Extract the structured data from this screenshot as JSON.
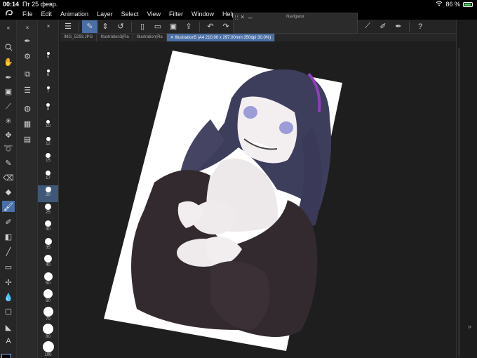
{
  "status": {
    "time": "00:14",
    "date": "Пт 25 февр.",
    "battery": "86 %"
  },
  "menu": [
    "File",
    "Edit",
    "Animation",
    "Layer",
    "Select",
    "View",
    "Filter",
    "Window",
    "Help"
  ],
  "navigator": {
    "title": "Navigator"
  },
  "tabs": [
    "IMG_5293.JPG",
    "Illustration3(Ra",
    "Illustration(Ra",
    "Illustration5 (A4 210.00 x 297.00mm 350dpi 30.0%)"
  ],
  "brush_sizes": [
    "5",
    "6",
    "7",
    "8",
    "10",
    "12",
    "15",
    "17",
    "20",
    "25",
    "30",
    "35",
    "40",
    "50",
    "60",
    "70",
    "80",
    "100"
  ],
  "selected_brush_size": "20",
  "colors": {
    "main": "#000000",
    "sub": "#ffffff",
    "accent": "#4a6fa5"
  }
}
